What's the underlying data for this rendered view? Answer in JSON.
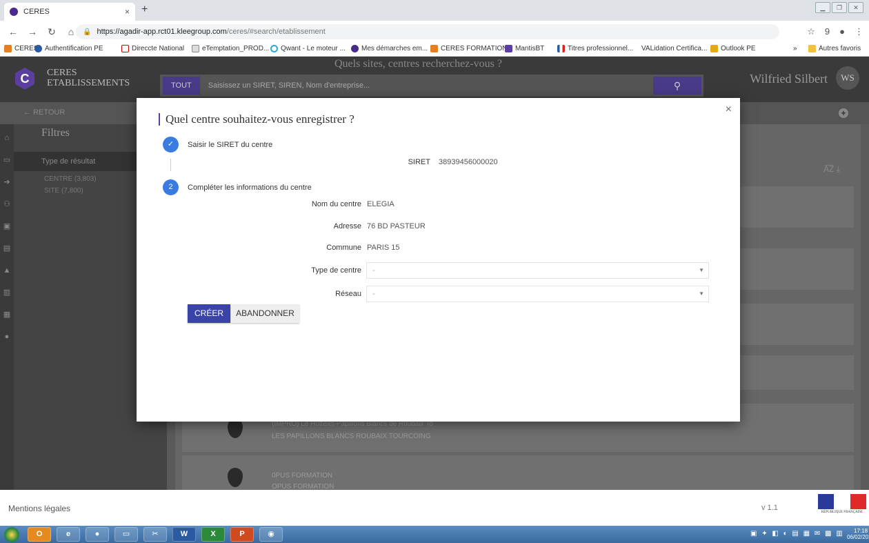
{
  "browser": {
    "tab_title": "CERES",
    "tab_close": "×",
    "new_tab": "+",
    "url_host": "https://agadir-app.rct01.kleegroup.com",
    "url_path": "/ceres/#search/etablissement",
    "profile_badge": "9",
    "bookmarks": [
      "CERES",
      "Authentification PE",
      "Direccte National",
      "eTemptation_PROD...",
      "Qwant - Le moteur ...",
      "Mes démarches em...",
      "CERES FORMATION",
      "MantisBT",
      "Titres professionnel...",
      "VALidation Certifica...",
      "Outlook PE"
    ],
    "bookmarks_more": "»",
    "other_bookmarks": "Autres favoris"
  },
  "app": {
    "brand_line1": "CERES",
    "brand_line2": "ETABLISSEMENTS",
    "search_title": "Quels sites, centres recherchez-vous ?",
    "search_scope": "TOUT",
    "search_placeholder": "Saisissez un SIRET, SIREN, Nom d'entreprise...",
    "user_name": "Wilfried Silbert",
    "user_initials": "WS",
    "back_label": "RETOUR"
  },
  "filters": {
    "title": "Filtres",
    "group_label": "Type de résultat",
    "options": [
      "CENTRE (3,803)",
      "SITE (7,800)"
    ]
  },
  "results": [
    {
      "line1": "(IMPRO) Le Hotteiet-Papillons Blancs de Roubaix To",
      "line2": "LES PAPILLONS BLANCS ROUBAIX TOURCOING"
    },
    {
      "line1": "0PUS FORMATION",
      "line2": "OPUS FORMATION"
    }
  ],
  "modal": {
    "title": "Quel centre souhaitez-vous enregistrer ?",
    "step1_label": "Saisir le SIRET du centre",
    "step2_number": "2",
    "step2_label": "Compléter les informations du centre",
    "siret_label": "SIRET",
    "siret_value": "38939456000020",
    "fields": {
      "nom_label": "Nom du centre",
      "nom_value": "ELEGIA",
      "adresse_label": "Adresse",
      "adresse_value": "76 BD PASTEUR",
      "commune_label": "Commune",
      "commune_value": "PARIS 15",
      "type_label": "Type de centre",
      "type_value": "-",
      "reseau_label": "Réseau",
      "reseau_value": "-"
    },
    "create_button": "CRÉER",
    "cancel_button": "ABANDONNER",
    "close": "×"
  },
  "footer": {
    "mentions": "Mentions légales",
    "version": "v 1.1",
    "rf_text": "RÉPUBLIQUE FRANÇAISE"
  },
  "taskbar": {
    "time": "17:18",
    "date": "06/02/2019"
  },
  "colors": {
    "accent": "#3a44a8",
    "step_blue": "#3a7be0",
    "brand_purple": "#5b3fa0"
  }
}
